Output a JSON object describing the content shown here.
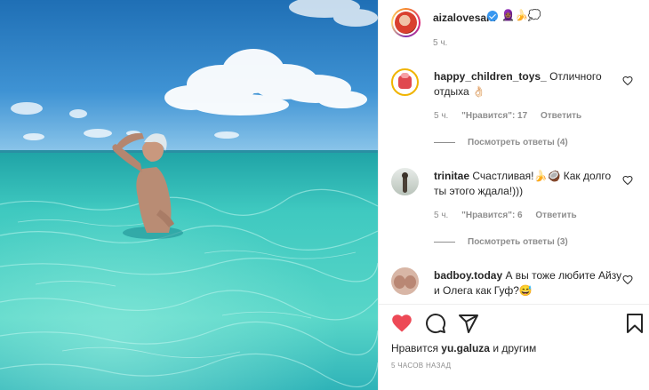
{
  "post": {
    "username": "aizalovesam",
    "header_emojis": "🧕🏾🍌💭",
    "time": "5 ч.",
    "liked_prefix": "Нравится",
    "liked_user": "yu.galuza",
    "liked_suffix": "и другим",
    "date": "5 ЧАСОВ НАЗАД",
    "like_state": "liked",
    "accent_like": "#ed4956",
    "verified_color": "#3897f0"
  },
  "comments": [
    {
      "username": "happy_children_toys_",
      "text": "Отличного отдыха 👌🏻",
      "time": "5 ч.",
      "likes": "\"Нравится\": 17",
      "reply": "Ответить",
      "view_replies": "Посмотреть ответы (4)"
    },
    {
      "username": "trinitae",
      "text": "Счастливая!🍌🥥 Как долго ты этого ждала!)))",
      "time": "5 ч.",
      "likes": "\"Нравится\": 6",
      "reply": "Ответить",
      "view_replies": "Посмотреть ответы (3)"
    },
    {
      "username": "badboy.today",
      "text": "А вы тоже любите Айзу и Олега как Гуф?😅"
    }
  ],
  "icons": {
    "like": "heart-icon",
    "comment": "comment-icon",
    "share": "share-icon",
    "save": "bookmark-icon",
    "comment_like": "heart-outline-icon"
  }
}
